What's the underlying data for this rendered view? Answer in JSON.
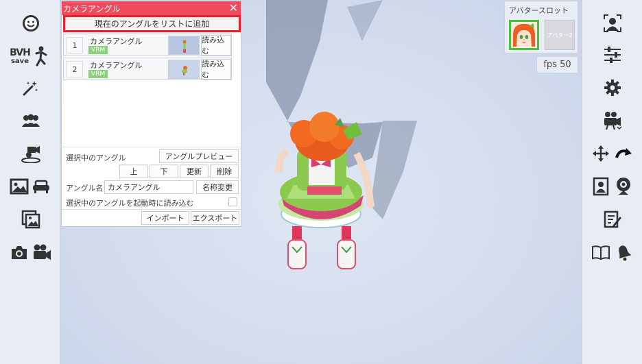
{
  "panel": {
    "title": "カメラアングル",
    "close_icon": "close-icon",
    "add_button": "現在のアングルをリストに追加",
    "angles": [
      {
        "index": "1",
        "name": "カメラアングル",
        "badge": "VRM",
        "load_label": "読み込む"
      },
      {
        "index": "2",
        "name": "カメラアングル",
        "badge": "VRM",
        "load_label": "読み込む"
      }
    ],
    "selected_label": "選択中のアングル",
    "preview_button": "アングルプレビュー",
    "up_button": "上",
    "down_button": "下",
    "update_button": "更新",
    "delete_button": "削除",
    "name_label": "アングル名",
    "name_value": "カメラアングル",
    "rename_button": "名称変更",
    "autoload_label": "選択中のアングルを起動時に読み込む",
    "autoload_checked": false,
    "import_button": "インポート",
    "export_button": "エクスポート"
  },
  "avatar_slot": {
    "title": "アバタースロット",
    "slot2_label": "アバター2"
  },
  "fps": {
    "text": "fps  50"
  },
  "left_toolbar": {
    "bvh_text": "BVH",
    "save_text": "save",
    "icons": [
      "face-icon",
      "bvh-save-icon",
      "pose-icon",
      "magic-wand-icon",
      "group-icon",
      "stage-camera-icon",
      "image-icon",
      "sofa-icon",
      "gallery-icon",
      "camera-icon",
      "video-camera-icon"
    ]
  },
  "right_toolbar": {
    "icons": [
      "face-tracking-icon",
      "sliders-icon",
      "gear-icon",
      "movie-camera-icon",
      "move-icon",
      "rotate-icon",
      "portrait-icon",
      "webcam-icon",
      "edit-icon",
      "book-icon",
      "bell-icon"
    ]
  },
  "colors": {
    "panel_header": "#ef4a5d",
    "highlight_border": "#e8202e",
    "vrm_badge": "#8ad37a",
    "avatar_selected": "#4bbf3e",
    "viewport_bg": "#d6deef"
  }
}
